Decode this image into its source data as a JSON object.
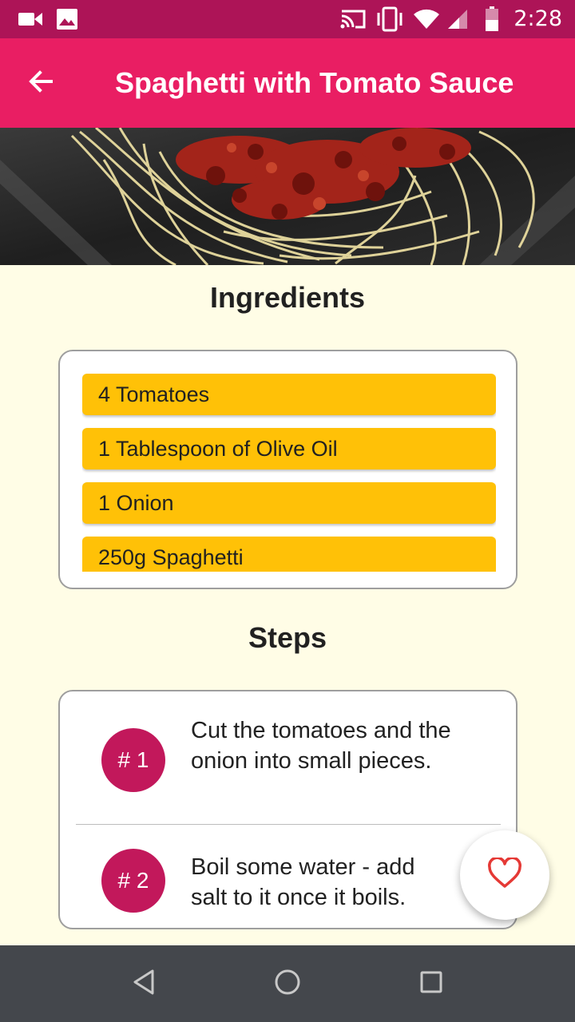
{
  "status_bar": {
    "time": "2:28",
    "left_icons": [
      "video-camera-icon",
      "image-icon"
    ],
    "right_icons": [
      "cast-icon",
      "vibrate-icon",
      "wifi-icon",
      "cell-signal-icon",
      "battery-icon"
    ]
  },
  "app_bar": {
    "title": "Spaghetti with Tomato Sauce",
    "back_icon": "arrow-back-icon",
    "color": "#E91E63"
  },
  "hero": {
    "image": "spaghetti-with-tomato-sauce-photo"
  },
  "ingredients": {
    "heading": "Ingredients",
    "items": [
      "4 Tomatoes",
      "1 Tablespoon of Olive Oil",
      "1 Onion",
      "250g Spaghetti"
    ],
    "item_color": "#FFC107"
  },
  "steps": {
    "heading": "Steps",
    "items": [
      {
        "number": "# 1",
        "text": "Cut the tomatoes and the onion into small pieces."
      },
      {
        "number": "# 2",
        "text": "Boil some water - add salt to it once it boils."
      }
    ],
    "badge_color": "#C2185B"
  },
  "fab": {
    "icon": "heart-outline-icon",
    "color": "#E53935"
  },
  "nav_bar": {
    "icons": [
      "back-triangle-icon",
      "home-circle-icon",
      "recents-square-icon"
    ]
  },
  "background_color": "#FFFDE6"
}
